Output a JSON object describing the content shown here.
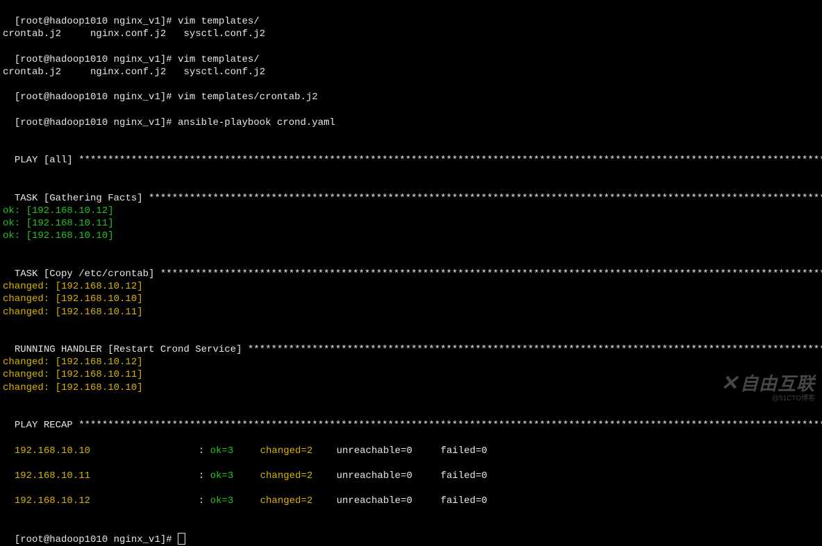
{
  "cmd": {
    "p1": "[root@hadoop1010 nginx_v1]# ",
    "vim_templates": "vim templates/",
    "file_list": "crontab.j2     nginx.conf.j2   sysctl.conf.j2",
    "vim_crontab": "vim templates/crontab.j2",
    "ansible_cmd": "ansible-playbook crond.yaml"
  },
  "play_all": {
    "label": "PLAY [all] "
  },
  "task_gather": {
    "label": "TASK [Gathering Facts] ",
    "lines": [
      "ok: [192.168.10.12]",
      "ok: [192.168.10.11]",
      "ok: [192.168.10.10]"
    ]
  },
  "task_copy": {
    "label": "TASK [Copy /etc/crontab] ",
    "lines": [
      "changed: [192.168.10.12]",
      "changed: [192.168.10.10]",
      "changed: [192.168.10.11]"
    ]
  },
  "handler": {
    "label": "RUNNING HANDLER [Restart Crond Service] ",
    "lines": [
      "changed: [192.168.10.12]",
      "changed: [192.168.10.11]",
      "changed: [192.168.10.10]"
    ]
  },
  "recap": {
    "label": "PLAY RECAP ",
    "rows": [
      {
        "host": "192.168.10.10",
        "ok": "ok=3",
        "changed": "changed=2",
        "unreach": "unreachable=0",
        "failed": "failed=0"
      },
      {
        "host": "192.168.10.11",
        "ok": "ok=3",
        "changed": "changed=2",
        "unreach": "unreachable=0",
        "failed": "failed=0"
      },
      {
        "host": "192.168.10.12",
        "ok": "ok=3",
        "changed": "changed=2",
        "unreach": "unreachable=0",
        "failed": "failed=0"
      }
    ],
    "sep": "                 : "
  },
  "asterisks_long": "******************************************************************************************************************************************",
  "asterisks_gather": "**************************************************************************************************************************",
  "asterisks_copy": "************************************************************************************************************************",
  "asterisks_handler": "*********************************************************************************************************",
  "asterisks_recap": "**************************************************************************************************************************************",
  "watermark": {
    "brand": "自由互联",
    "sub": "@51CTO博客"
  }
}
